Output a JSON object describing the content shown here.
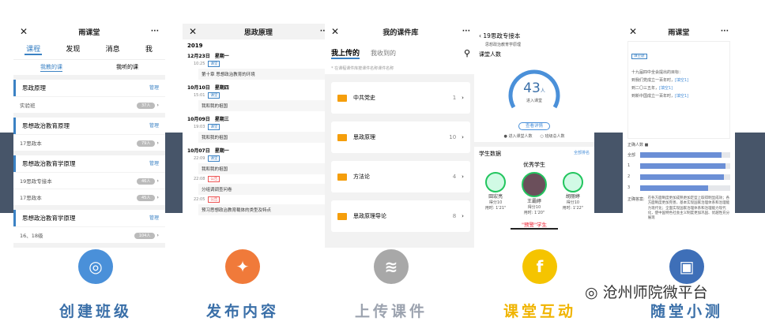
{
  "p1": {
    "title": "雨课堂",
    "tabs": [
      "课程",
      "发现",
      "消息",
      "我"
    ],
    "subtabs": [
      "我教的课",
      "我听的课"
    ],
    "manage": "管理",
    "courses": [
      {
        "name": "思政原理",
        "rows": [
          {
            "cls": "实验班",
            "count": "37人"
          }
        ]
      },
      {
        "name": "思想政治教育原理",
        "rows": [
          {
            "cls": "17思政本",
            "count": "79人"
          }
        ]
      },
      {
        "name": "思想政治教育学原理",
        "rows": [
          {
            "cls": "19思政专接本",
            "count": "46人"
          },
          {
            "cls": "17思政本",
            "count": "45人"
          }
        ]
      },
      {
        "name": "思想政治教育学原理",
        "rows": [
          {
            "cls": "16、18级",
            "count": "104人"
          }
        ]
      }
    ]
  },
  "p2": {
    "title": "思政原理",
    "year": "2019",
    "events": [
      {
        "date": "12月23日　星期一",
        "items": [
          {
            "time": "10:25",
            "tag": "课堂",
            "red": false,
            "text": "第十章 思想政治教育的环境"
          }
        ]
      },
      {
        "date": "10月10日　星期四",
        "items": [
          {
            "time": "15:01",
            "tag": "课堂",
            "red": false,
            "text": "我和我的祖国"
          }
        ]
      },
      {
        "date": "10月09日　星期三",
        "items": [
          {
            "time": "19:03",
            "tag": "课堂",
            "red": false,
            "text": "我和我的祖国"
          }
        ]
      },
      {
        "date": "10月07日　星期一",
        "items": [
          {
            "time": "22:09",
            "tag": "课堂",
            "red": false,
            "text": "我和我的祖国"
          },
          {
            "time": "22:08",
            "tag": "公告",
            "red": true,
            "text": "分组调调查问卷"
          },
          {
            "time": "22:05",
            "tag": "公告",
            "red": true,
            "text": "预习思想政治教育载体的类型及特点"
          }
        ]
      }
    ]
  },
  "p3": {
    "title": "我的课件库",
    "tab_on": "我上传的",
    "tab_off": "我收到的",
    "note": "* 在课程课件库按课件名称课件名称",
    "folders": [
      {
        "name": "中共党史",
        "count": "1"
      },
      {
        "name": "思政原理",
        "count": "10"
      },
      {
        "name": "方法论",
        "count": "4"
      },
      {
        "name": "思政原理导论",
        "count": "8"
      }
    ]
  },
  "p4": {
    "back_title": "19思政专接本",
    "subtitle": "思想政治教育学原理",
    "people_label": "课堂人数",
    "count": "43",
    "unit": "人",
    "enter_label": "进入课堂",
    "detail_btn": "查看详情",
    "legend": [
      "进入课堂人数",
      "班级总人数"
    ],
    "student_label": "学生数据",
    "rank_link": "全部排名",
    "excellent": "优秀学生",
    "students": [
      {
        "name": "田宏亮",
        "score": "得分10",
        "time": "用时: 1'21\""
      },
      {
        "name": "王霸婷",
        "score": "得分10",
        "time": "用时: 1'20\""
      },
      {
        "name": "胡丽婷",
        "score": "得分10",
        "time": "用时: 1'22\""
      }
    ],
    "warn": "\"预警\"学生"
  },
  "p5": {
    "title": "雨课堂",
    "tag": "填空题",
    "lines": [
      "十九届四中全会提出的目标：",
      "到我们党成立一百年时，",
      "到二〇三五年，",
      "到新中国成立一百年时，"
    ],
    "fill": "[填空1]",
    "correct_label": "正确人数",
    "bars": [
      {
        "label": "全部",
        "value": 0.9
      },
      {
        "label": "1",
        "value": 0.95
      },
      {
        "label": "2",
        "value": 0.93
      },
      {
        "label": "3",
        "value": 0.75
      }
    ],
    "answer_label": "正确答案:",
    "answer": "在各方面制度更加成熟更加定型上取得明显成效；各方面制度更加完善，基本实现国家治理体系和治理能力现代化；全面实现国家治理体系和治理能力现代化，使中国特色社会主义制度更加巩固、优越性充分展现"
  },
  "labels": [
    "创建班级",
    "发布内容",
    "上传课件",
    "课堂互动",
    "随堂小测"
  ],
  "label_colors": [
    "#3a6fa8",
    "#3a6fa8",
    "#9ca3af",
    "#f0b400",
    "#3a6fa8"
  ],
  "icon_colors": [
    "#4a90d9",
    "#f07a3a",
    "#a8a8a8",
    "#f5c400",
    "#3e6fb8"
  ],
  "icons": [
    "target-icon",
    "twitter-icon",
    "rss-icon",
    "facebook-icon",
    "box-icon"
  ],
  "watermark": "沧州师院微平台"
}
